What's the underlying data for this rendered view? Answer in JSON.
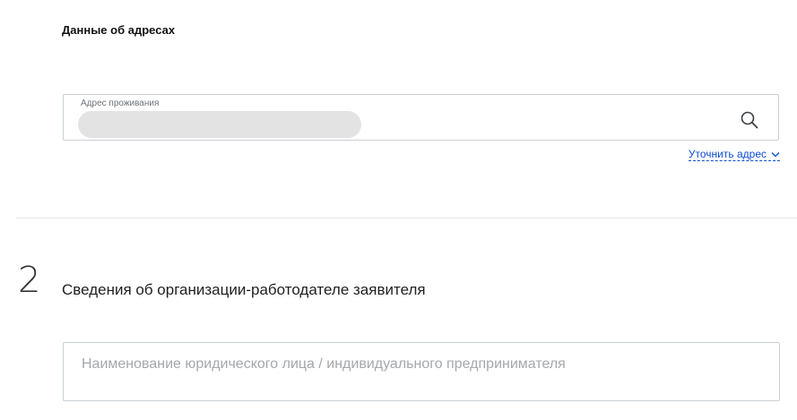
{
  "addresses_section": {
    "title": "Данные об адресах",
    "residence_address": {
      "label": "Адрес проживания",
      "value_state": "redacted",
      "search_icon": "search-icon"
    },
    "clarify_link": "Уточнить адрес",
    "clarify_icon": "chevron-down-icon"
  },
  "step2": {
    "number": "2",
    "title": "Сведения об организации-работодателе заявителя",
    "org_name_field": {
      "value": "",
      "placeholder": "Наименование юридического лица / индивидуального предпринимателя"
    }
  },
  "colors": {
    "link": "#0d4cd3",
    "border": "#c9ced3",
    "redacted_fill": "#e3e3e3"
  }
}
